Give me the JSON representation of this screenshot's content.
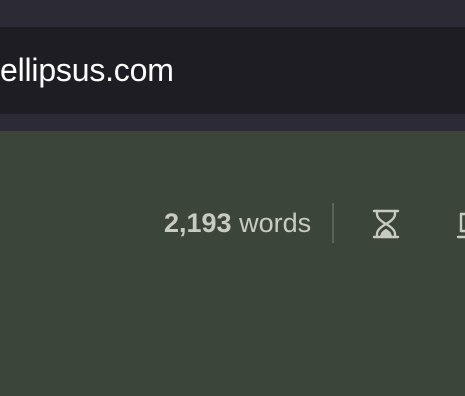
{
  "browser": {
    "url": "ellipsus.com"
  },
  "editor_toolbar": {
    "word_count_number": "2,193",
    "word_count_unit": "words",
    "icons": {
      "timer": "hourglass-icon",
      "partial": "partial-toolbar-icon"
    }
  },
  "colors": {
    "browser_chrome": "#2c2b35",
    "url_bar": "#1e1d23",
    "page_background": "#3b4639",
    "toolbar_text": "#c8cbbd"
  }
}
